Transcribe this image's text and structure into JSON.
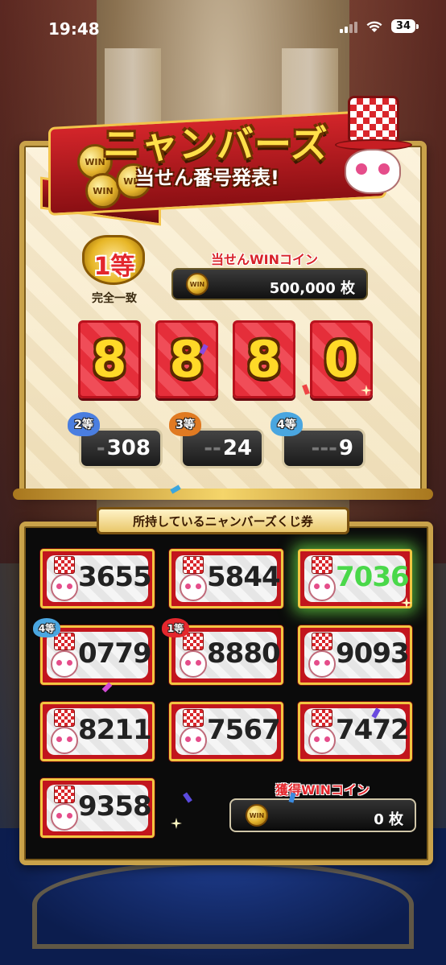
{
  "status": {
    "time": "19:48",
    "battery": "34"
  },
  "banner": {
    "title": "ニャンバーズ",
    "subtitle": "当せん番号発表!"
  },
  "coin_text": "WIN",
  "first_prize": {
    "rank": "1等",
    "rank_desc": "完全一致",
    "win_label": "当せんWINコイン",
    "amount": "500,000 枚",
    "digits": [
      "8",
      "8",
      "8",
      "0"
    ]
  },
  "sub_prizes": [
    {
      "rank": "2等",
      "dashes": "-",
      "number": "308",
      "color": "#4a7ee0"
    },
    {
      "rank": "3等",
      "dashes": "--",
      "number": "24",
      "color": "#e07a22"
    },
    {
      "rank": "4等",
      "dashes": "---",
      "number": "9",
      "color": "#4aa6e0"
    }
  ],
  "owned": {
    "header": "所持しているニャンバーズくじ券",
    "tickets": [
      {
        "number": "3655",
        "badge": "",
        "highlight": false
      },
      {
        "number": "5844",
        "badge": "",
        "highlight": false
      },
      {
        "number": "7036",
        "badge": "",
        "highlight": true
      },
      {
        "number": "0779",
        "badge": "4等",
        "highlight": false
      },
      {
        "number": "8880",
        "badge": "1等",
        "highlight": false
      },
      {
        "number": "9093",
        "badge": "",
        "highlight": false
      },
      {
        "number": "8211",
        "badge": "",
        "highlight": false
      },
      {
        "number": "7567",
        "badge": "",
        "highlight": false
      },
      {
        "number": "7472",
        "badge": "",
        "highlight": false
      },
      {
        "number": "9358",
        "badge": "",
        "highlight": false
      }
    ],
    "earned_label": "獲得WINコイン",
    "earned_amount": "0 枚"
  },
  "colors": {
    "gold": "#c9a24a",
    "red": "#e52e3a",
    "badge_first": "#e3272d",
    "badge_fourth": "#4aa6e0"
  }
}
